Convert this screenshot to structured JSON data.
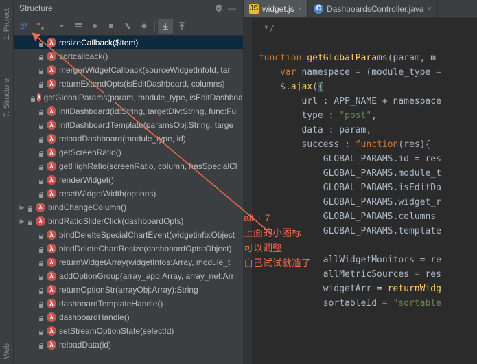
{
  "gutter": {
    "tabs": [
      "1: Project",
      "7: Structure",
      "Web"
    ]
  },
  "structure": {
    "title": "Structure",
    "toolbar_icons": [
      "sort-alpha",
      "sort-visibility",
      "expand",
      "scope1",
      "scope2",
      "scope3",
      "scope4",
      "scope5",
      "autoscroll-to",
      "autoscroll-from"
    ],
    "items": [
      {
        "label": "resizeCallback($item)",
        "selected": true,
        "indent": 1
      },
      {
        "label": "sortcallback()",
        "indent": 1
      },
      {
        "label": "mergerWidgetCallback(sourceWidgetInfoId, tar",
        "indent": 1
      },
      {
        "label": "returnExtendOpts(isEditDashboard, columns)",
        "indent": 1
      },
      {
        "label": "getGlobalParams(param, module_type, isEditDashboard, func:Function)",
        "indent": 1,
        "wide": true
      },
      {
        "label": "initDashboard(id:String, targetDiv:String, func:Fu",
        "indent": 1
      },
      {
        "label": "initDashboardTemplate(paramsObj:String, targe",
        "indent": 1
      },
      {
        "label": "reloadDashboard(module_type, id)",
        "indent": 1
      },
      {
        "label": "getScreenRatio()",
        "indent": 1
      },
      {
        "label": "getHighRatio(screenRatio, column, hasSpecialCl",
        "indent": 1
      },
      {
        "label": "renderWidget()",
        "indent": 1
      },
      {
        "label": "resetWidgetWidth(options)",
        "indent": 1
      },
      {
        "label": "bindChangeColumn()",
        "indent": 0,
        "expand": true
      },
      {
        "label": "bindRatioSliderClick(dashboardOpts)",
        "indent": 0,
        "expand": true
      },
      {
        "label": "bindDeleIteSpecialChartEvent(widgetinfo:Object",
        "indent": 1
      },
      {
        "label": "bindDeleteChartResize(dashboardOpts:Object)",
        "indent": 1
      },
      {
        "label": "returnWidgetArray(widgetInfos:Array, module_t",
        "indent": 1
      },
      {
        "label": "addOptionGroup(array_app:Array, array_net:Arr",
        "indent": 1
      },
      {
        "label": "returnOptionStr(arrayObj:Array):String",
        "indent": 1
      },
      {
        "label": "dashboardTemplateHandle()",
        "indent": 1
      },
      {
        "label": "dashboardHandle()",
        "indent": 1
      },
      {
        "label": "setStreamOptionState(selectId)",
        "indent": 1
      },
      {
        "label": "reloadData(id)",
        "indent": 1
      }
    ]
  },
  "editor": {
    "tabs": [
      {
        "name": "widget.js",
        "type": "js",
        "active": true
      },
      {
        "name": "DashboardsController.java",
        "type": "java",
        "active": false
      }
    ],
    "code": {
      "l1": "*/",
      "l2a": "function",
      "l2b": "getGlobalParams",
      "l2c": "(param, m",
      "l3a": "var",
      "l3b": " namespace = (module_type =",
      "l4a": "$.",
      "l4b": "ajax",
      "l4c": "(",
      "l4d": "{",
      "l5a": "url : APP_NAME + namespace",
      "l6a": "type : ",
      "l6b": "\"post\"",
      "l6c": ",",
      "l7a": "data : param,",
      "l8a": "success : ",
      "l8b": "function",
      "l8c": "(res){",
      "l9": "GLOBAL_PARAMS.id = res",
      "l10": "GLOBAL_PARAMS.module_t",
      "l11": "GLOBAL_PARAMS.isEditDa",
      "l12": "GLOBAL_PARAMS.widget_r",
      "l13": "GLOBAL_PARAMS.columns",
      "l14": "GLOBAL_PARAMS.template",
      "l15": "",
      "l16": "allWidgetMonitors = re",
      "l17": "allMetricSources = res",
      "l18a": "widgetArr = ",
      "l18b": "returnWidg",
      "l19a": "sortableId = ",
      "l19b": "\"sortable"
    }
  },
  "annotation": {
    "line1": "alt + 7",
    "line2": "上面的小图标",
    "line3": "可以调整",
    "line4": "自己试试就造了"
  }
}
